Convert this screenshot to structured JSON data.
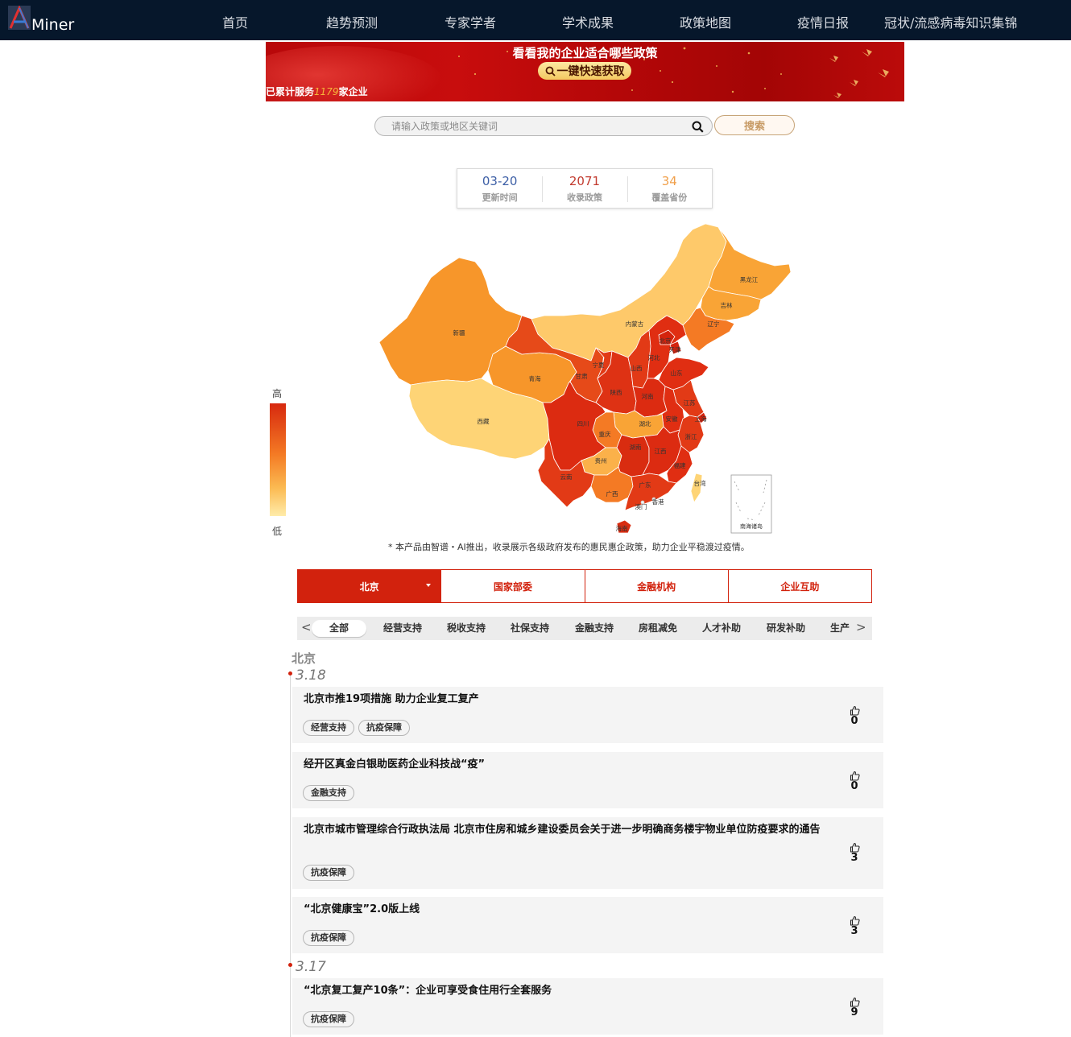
{
  "nav": {
    "logo_text": "Miner",
    "items": [
      "首页",
      "趋势预测",
      "专家学者",
      "学术成果",
      "政策地图",
      "疫情日报",
      "冠状/流感病毒知识集锦"
    ]
  },
  "banner": {
    "title": "看看我的企业适合哪些政策",
    "button_label": "一键快速获取",
    "served_prefix": "已累计服务",
    "served_count": "1179",
    "served_suffix": "家企业"
  },
  "search": {
    "placeholder": "请输入政策或地区关键词",
    "button_label": "搜索"
  },
  "stats": [
    {
      "value": "03-20",
      "label": "更新时间",
      "color": "#3d5fa6"
    },
    {
      "value": "2071",
      "label": "收录政策",
      "color": "#c23b2f"
    },
    {
      "value": "34",
      "label": "覆盖省份",
      "color": "#f0a04b"
    }
  ],
  "map": {
    "legend_high": "高",
    "legend_low": "低",
    "legend_colors": [
      "#d7290f",
      "#f47a24",
      "#fbba52",
      "#ffecaa"
    ],
    "provinces": [
      {
        "name": "黑龙江",
        "level": "mid"
      },
      {
        "name": "吉林",
        "level": "mid"
      },
      {
        "name": "辽宁",
        "level": "mid-high"
      },
      {
        "name": "内蒙古",
        "level": "low"
      },
      {
        "name": "北京",
        "level": "high"
      },
      {
        "name": "天津",
        "level": "high"
      },
      {
        "name": "河北",
        "level": "high"
      },
      {
        "name": "山西",
        "level": "high"
      },
      {
        "name": "山东",
        "level": "high"
      },
      {
        "name": "新疆",
        "level": "mid"
      },
      {
        "name": "青海",
        "level": "mid"
      },
      {
        "name": "甘肃",
        "level": "high"
      },
      {
        "name": "宁夏",
        "level": "high"
      },
      {
        "name": "陕西",
        "level": "high"
      },
      {
        "name": "河南",
        "level": "high"
      },
      {
        "name": "江苏",
        "level": "high"
      },
      {
        "name": "西藏",
        "level": "low"
      },
      {
        "name": "四川",
        "level": "high"
      },
      {
        "name": "重庆",
        "level": "mid"
      },
      {
        "name": "湖北",
        "level": "low"
      },
      {
        "name": "安徽",
        "level": "high"
      },
      {
        "name": "上海",
        "level": "high"
      },
      {
        "name": "浙江",
        "level": "high"
      },
      {
        "name": "湖南",
        "level": "high"
      },
      {
        "name": "江西",
        "level": "high"
      },
      {
        "name": "贵州",
        "level": "low-mid"
      },
      {
        "name": "福建",
        "level": "high"
      },
      {
        "name": "云南",
        "level": "high"
      },
      {
        "name": "广西",
        "level": "mid"
      },
      {
        "name": "广东",
        "level": "high"
      },
      {
        "name": "台湾",
        "level": "low"
      },
      {
        "name": "香港",
        "level": "none"
      },
      {
        "name": "澳门",
        "level": "none"
      },
      {
        "name": "海南",
        "level": "high"
      }
    ],
    "inset_label": "南海诸岛"
  },
  "footnote": "* 本产品由智谱・AI推出，收录展示各级政府发布的惠民惠企政策，助力企业平稳渡过疫情。",
  "region_tabs": [
    "北京",
    "国家部委",
    "金融机构",
    "企业互助"
  ],
  "categories": [
    "全部",
    "经营支持",
    "税收支持",
    "社保支持",
    "金融支持",
    "房租减免",
    "人才补助",
    "研发补助",
    "生产"
  ],
  "list": {
    "region_heading": "北京",
    "groups": [
      {
        "date": "3.18",
        "items": [
          {
            "title": "北京市推19项措施 助力企业复工复产",
            "tags": [
              "经营支持",
              "抗疫保障"
            ],
            "likes": "0"
          },
          {
            "title": "经开区真金白银助医药企业科技战“疫”",
            "tags": [
              "金融支持"
            ],
            "likes": "0"
          },
          {
            "title": "北京市城市管理综合行政执法局 北京市住房和城乡建设委员会关于进一步明确商务楼宇物业单位防疫要求的通告",
            "tags": [
              "抗疫保障"
            ],
            "likes": "3"
          },
          {
            "title": "“北京健康宝”2.0版上线",
            "tags": [
              "抗疫保障"
            ],
            "likes": "3"
          }
        ]
      },
      {
        "date": "3.17",
        "items": [
          {
            "title": "“北京复工复产10条”：企业可享受食住用行全套服务",
            "tags": [
              "抗疫保障"
            ],
            "likes": "9"
          }
        ]
      }
    ]
  }
}
